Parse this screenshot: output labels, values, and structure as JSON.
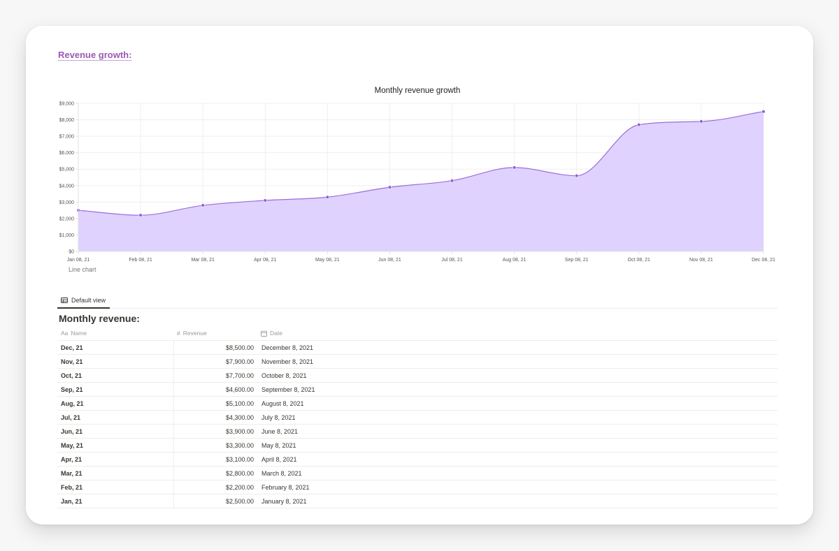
{
  "page": {
    "heading": "Revenue growth:"
  },
  "chart_data": {
    "type": "area",
    "title": "Monthly revenue growth",
    "caption": "Line chart",
    "x": [
      "Jan 08, 21",
      "Feb 08, 21",
      "Mar 08, 21",
      "Apr 08, 21",
      "May 08, 21",
      "Jun 08, 21",
      "Jul 08, 21",
      "Aug 08, 21",
      "Sep 08, 21",
      "Oct 08, 21",
      "Nov 08, 21",
      "Dec 08, 21"
    ],
    "series": [
      {
        "values": [
          2500,
          2200,
          2800,
          3100,
          3300,
          3900,
          4300,
          5100,
          4600,
          7700,
          7900,
          8500
        ]
      }
    ],
    "yticks": [
      "$0",
      "$1,000",
      "$2,000",
      "$3,000",
      "$4,000",
      "$5,000",
      "$6,000",
      "$7,000",
      "$8,000",
      "$9,000"
    ],
    "ylim": [
      0,
      9000
    ],
    "grid": true,
    "colors": {
      "line": "#9b6ddb",
      "fill": "#ddd0ff",
      "point": "#8e5fd6"
    }
  },
  "view": {
    "tab_label": "Default view"
  },
  "table": {
    "title": "Monthly revenue:",
    "columns": [
      {
        "label": "Name",
        "icon": "Aa"
      },
      {
        "label": "Revenue",
        "icon": "#"
      },
      {
        "label": "Date",
        "icon": "calendar-icon"
      }
    ],
    "rows": [
      {
        "name": "Dec, 21",
        "revenue": "$8,500.00",
        "date": "December 8, 2021"
      },
      {
        "name": "Nov, 21",
        "revenue": "$7,900.00",
        "date": "November 8, 2021"
      },
      {
        "name": "Oct, 21",
        "revenue": "$7,700.00",
        "date": "October 8, 2021"
      },
      {
        "name": "Sep, 21",
        "revenue": "$4,600.00",
        "date": "September 8, 2021"
      },
      {
        "name": "Aug, 21",
        "revenue": "$5,100.00",
        "date": "August 8, 2021"
      },
      {
        "name": "Jul, 21",
        "revenue": "$4,300.00",
        "date": "July 8, 2021"
      },
      {
        "name": "Jun, 21",
        "revenue": "$3,900.00",
        "date": "June 8, 2021"
      },
      {
        "name": "May, 21",
        "revenue": "$3,300.00",
        "date": "May 8, 2021"
      },
      {
        "name": "Apr, 21",
        "revenue": "$3,100.00",
        "date": "April 8, 2021"
      },
      {
        "name": "Mar, 21",
        "revenue": "$2,800.00",
        "date": "March 8, 2021"
      },
      {
        "name": "Feb, 21",
        "revenue": "$2,200.00",
        "date": "February 8, 2021"
      },
      {
        "name": "Jan, 21",
        "revenue": "$2,500.00",
        "date": "January 8, 2021"
      }
    ]
  }
}
